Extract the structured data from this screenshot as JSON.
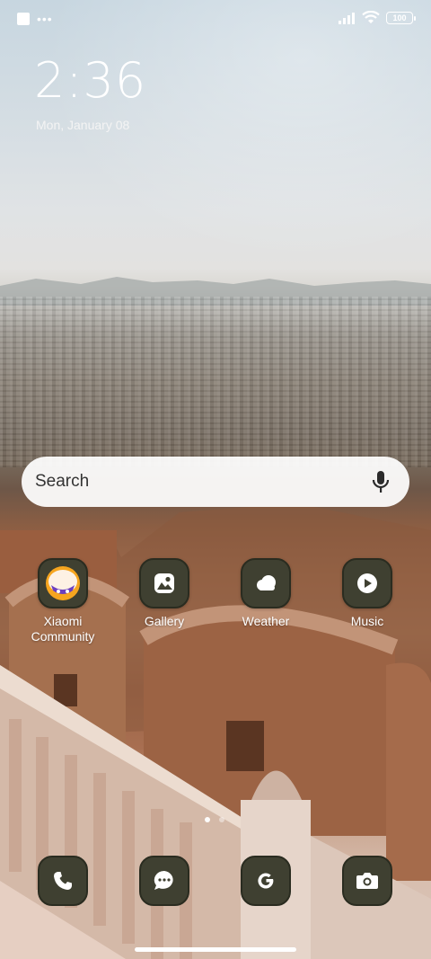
{
  "status_bar": {
    "battery_level": "100",
    "icons": [
      "notification-square-icon",
      "more-dots-icon",
      "signal-icon",
      "wifi-icon",
      "battery-icon"
    ],
    "more_dots": "•••"
  },
  "lock_clock": {
    "time": "2:36",
    "date": "Mon, January 08"
  },
  "search": {
    "label": "Search",
    "icon": "mic-icon"
  },
  "apps": [
    {
      "label": "Xiaomi\nCommunity",
      "icon": "xiaomi-community-icon"
    },
    {
      "label": "Gallery",
      "icon": "gallery-icon"
    },
    {
      "label": "Weather",
      "icon": "weather-icon"
    },
    {
      "label": "Music",
      "icon": "music-icon"
    }
  ],
  "dock": [
    {
      "icon": "phone-icon"
    },
    {
      "icon": "messages-icon"
    },
    {
      "icon": "google-icon"
    },
    {
      "icon": "camera-icon"
    }
  ],
  "pager": {
    "pages": 2,
    "current": 1
  },
  "colors": {
    "icon_background": "#3f4031",
    "icon_glyph": "#ffffff",
    "search_background": "#ffffff"
  }
}
